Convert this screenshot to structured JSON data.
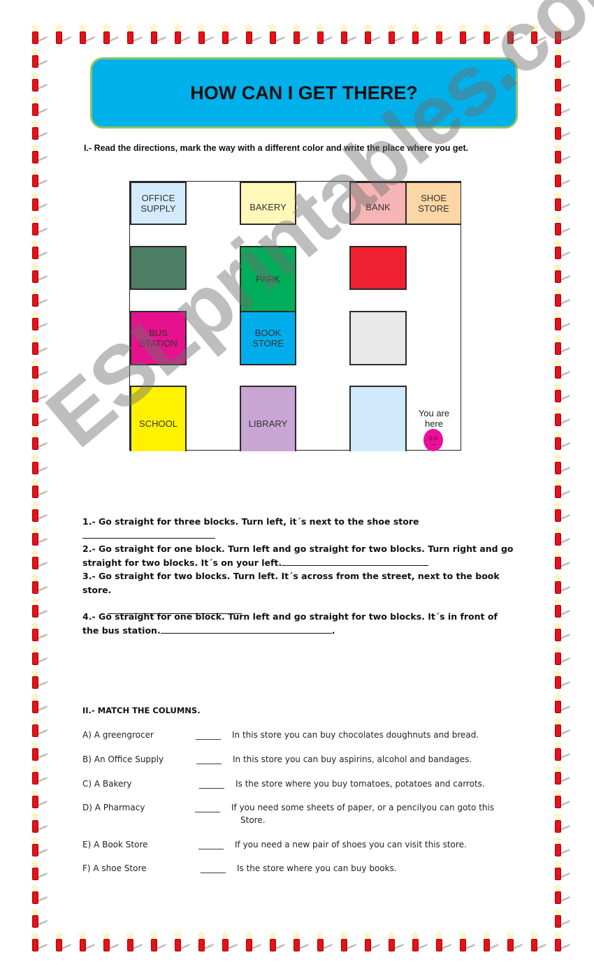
{
  "title": "HOW CAN I GET THERE?",
  "section1": {
    "instruction": "I.- Read the directions, mark the way with a different color and write the place where you get."
  },
  "map": {
    "blocks": [
      {
        "label": "OFFICE\nSUPPLY",
        "color": "#d3ebfb"
      },
      {
        "label": "BAKERY",
        "color": "#fff8b8"
      },
      {
        "label": "BANK",
        "color": "#f7b4b4"
      },
      {
        "label": "SHOE\nSTORE",
        "color": "#fcd6a4"
      },
      {
        "label": "",
        "color": "#4f7e66"
      },
      {
        "label": "PARK",
        "color": "#00ad5a"
      },
      {
        "label": "",
        "color": "#ef2130"
      },
      {
        "label": "BUS\nSTATION",
        "color": "#e6128d"
      },
      {
        "label": "BOOK\nSTORE",
        "color": "#00adeb"
      },
      {
        "label": "",
        "color": "#e9e9e9"
      },
      {
        "label": "SCHOOL",
        "color": "#fff200"
      },
      {
        "label": "LIBRARY",
        "color": "#c8a5d2"
      },
      {
        "label": "",
        "color": "#d0eafb"
      }
    ],
    "you_are_here": "You are\nhere"
  },
  "questions": [
    {
      "text": "1.- Go straight for three blocks. Turn left, it´s next to the shoe store"
    },
    {
      "text": "2.- Go straight for one block. Turn left and go straight for two blocks. Turn right and go straight for two blocks. It´s on your left."
    },
    {
      "text": "3.- Go straight for two blocks. Turn left. It´s across from the street, next to the book store."
    },
    {
      "text": "4.- Go straight for one block. Turn left and go straight for two blocks. It´s in front of the bus station.",
      "end": "."
    }
  ],
  "section2": {
    "heading": "II.- MATCH THE COLUMNS.",
    "blank": "______",
    "rows": [
      {
        "left": "A) A greengrocer",
        "right": "In this store you can buy chocolates doughnuts and bread."
      },
      {
        "left": "B) An Office Supply",
        "right": "In this store you can buy aspirins, alcohol and bandages."
      },
      {
        "left": "C) A Bakery",
        "right": "Is the store where you buy tomatoes, potatoes and carrots."
      },
      {
        "left": "D) A Pharmacy",
        "right": "If you need some sheets of paper, or a pencilyou can goto this",
        "right2": "Store."
      },
      {
        "left": "E) A Book Store",
        "right": "If you need a new pair of shoes you can visit this store."
      },
      {
        "left": "F) A shoe Store",
        "right": "Is the store where you can buy books."
      }
    ]
  },
  "watermark": "ESLprintables.com"
}
